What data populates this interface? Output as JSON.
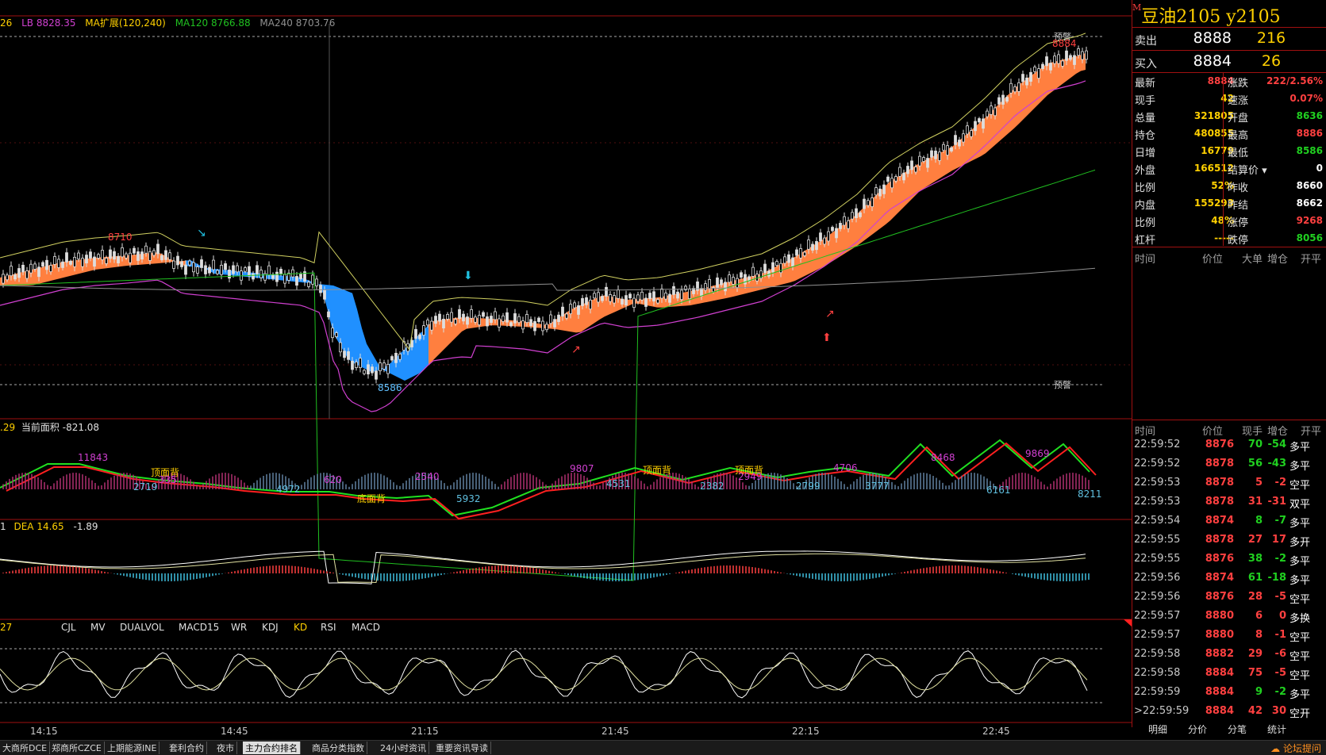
{
  "top_info": {
    "cut_value": "26",
    "lb": "LB 8828.35",
    "ma_ext": "MA扩展(120,240)",
    "ma120": "MA120 8766.88",
    "ma240": "MA240 8703.76"
  },
  "main_chart": {
    "price_high_label": "8884",
    "price_labels": [
      "8710",
      "8586"
    ],
    "warn_top": "预警",
    "warn_bottom": "预警",
    "colors": {
      "up_band": "#ff7f3f",
      "down_band": "#2090ff",
      "ma120": "#20c020",
      "ma240": "#909090",
      "boll": "#d0d060",
      "lower": "#d040d0"
    }
  },
  "volume_panel": {
    "header_prefix": ".29",
    "header": "当前面积 -821.08",
    "labels": [
      "11843",
      "顶面背",
      "2719",
      "335",
      "4972",
      "620",
      "底面背",
      "2540",
      "5932",
      "9807",
      "4531",
      "顶面背",
      "2382",
      "顶面背",
      "2949",
      "2799",
      "4706",
      "3777",
      "8468",
      "6161",
      "9869",
      "8211"
    ]
  },
  "macd_panel": {
    "header_prefix": "1",
    "dea": "DEA 14.65",
    "macd": "-1.89"
  },
  "indicator_tabs": {
    "cut": "27",
    "items": [
      "CJL",
      "MV",
      "DUALVOL",
      "MACD15",
      "WR",
      "KDJ",
      "KD",
      "RSI",
      "MACD"
    ],
    "active": "KD"
  },
  "time_axis": [
    "14:15",
    "14:45",
    "21:15",
    "21:45",
    "22:15",
    "22:45"
  ],
  "quote": {
    "title_mark": "M",
    "title": "豆油2105  y2105",
    "ask_label": "卖出",
    "ask_price": "8888",
    "ask_vol": "216",
    "bid_label": "买入",
    "bid_price": "8884",
    "bid_vol": "26",
    "stats_left": [
      {
        "label": "最新",
        "value": "8884",
        "color": "#ff4040"
      },
      {
        "label": "现手",
        "value": "42",
        "color": "#ffd000"
      },
      {
        "label": "总量",
        "value": "321805",
        "color": "#ffd000"
      },
      {
        "label": "持仓",
        "value": "480855",
        "color": "#ffd000"
      },
      {
        "label": "日增",
        "value": "16779",
        "color": "#ffd000"
      },
      {
        "label": "外盘",
        "value": "166512",
        "color": "#ffd000"
      },
      {
        "label": "比例",
        "value": "52%",
        "color": "#ffd000"
      },
      {
        "label": "内盘",
        "value": "155293",
        "color": "#ffd000"
      },
      {
        "label": "比例",
        "value": "48%",
        "color": "#ffd000"
      },
      {
        "label": "杠杆",
        "value": "-----",
        "color": "#ffd000"
      }
    ],
    "stats_right": [
      {
        "label": "涨跌",
        "value": "222/2.56%",
        "color": "#ff4040"
      },
      {
        "label": "速涨",
        "value": "0.07%",
        "color": "#ff4040"
      },
      {
        "label": "开盘",
        "value": "8636",
        "color": "#20d020"
      },
      {
        "label": "最高",
        "value": "8886",
        "color": "#ff4040"
      },
      {
        "label": "最低",
        "value": "8586",
        "color": "#20d020"
      },
      {
        "label": "结算价",
        "value": "0",
        "color": "#ffffff"
      },
      {
        "label": "昨收",
        "value": "8660",
        "color": "#ffffff"
      },
      {
        "label": "昨结",
        "value": "8662",
        "color": "#ffffff"
      },
      {
        "label": "涨停",
        "value": "9268",
        "color": "#ff4040"
      },
      {
        "label": "跌停",
        "value": "8056",
        "color": "#20d020"
      }
    ],
    "table_head": [
      "时间",
      "价位",
      "大单",
      "增仓",
      "开平"
    ],
    "tick_head": [
      "时间",
      "价位",
      "现手",
      "增仓",
      "开平"
    ]
  },
  "ticks": [
    {
      "time": "22:59:52",
      "price": "8876",
      "vol": "70",
      "oi": "-54",
      "type": "多平",
      "vc": "#20d020",
      "tc": "#ffffff"
    },
    {
      "time": "22:59:52",
      "price": "8878",
      "vol": "56",
      "oi": "-43",
      "type": "多平",
      "vc": "#20d020",
      "tc": "#ffffff"
    },
    {
      "time": "22:59:53",
      "price": "8878",
      "vol": "5",
      "oi": "-2",
      "type": "空平",
      "vc": "#ff4040",
      "tc": "#ffffff"
    },
    {
      "time": "22:59:53",
      "price": "8878",
      "vol": "31",
      "oi": "-31",
      "type": "双平",
      "vc": "#ff4040",
      "tc": "#ffffff"
    },
    {
      "time": "22:59:54",
      "price": "8874",
      "vol": "8",
      "oi": "-7",
      "type": "多平",
      "vc": "#20d020",
      "tc": "#ffffff"
    },
    {
      "time": "22:59:55",
      "price": "8878",
      "vol": "27",
      "oi": "17",
      "type": "多开",
      "vc": "#ff4040",
      "tc": "#ffffff"
    },
    {
      "time": "22:59:55",
      "price": "8876",
      "vol": "38",
      "oi": "-2",
      "type": "多平",
      "vc": "#20d020",
      "tc": "#ffffff"
    },
    {
      "time": "22:59:56",
      "price": "8874",
      "vol": "61",
      "oi": "-18",
      "type": "多平",
      "vc": "#20d020",
      "tc": "#ffffff"
    },
    {
      "time": "22:59:56",
      "price": "8876",
      "vol": "28",
      "oi": "-5",
      "type": "空平",
      "vc": "#ff4040",
      "tc": "#ffffff"
    },
    {
      "time": "22:59:57",
      "price": "8880",
      "vol": "6",
      "oi": "0",
      "type": "多换",
      "vc": "#ff4040",
      "tc": "#ffffff"
    },
    {
      "time": "22:59:57",
      "price": "8880",
      "vol": "8",
      "oi": "-1",
      "type": "空平",
      "vc": "#ff4040",
      "tc": "#ffffff"
    },
    {
      "time": "22:59:58",
      "price": "8882",
      "vol": "29",
      "oi": "-6",
      "type": "空平",
      "vc": "#ff4040",
      "tc": "#ffffff"
    },
    {
      "time": "22:59:58",
      "price": "8884",
      "vol": "75",
      "oi": "-5",
      "type": "空平",
      "vc": "#ff4040",
      "tc": "#ffffff"
    },
    {
      "time": "22:59:59",
      "price": "8884",
      "vol": "9",
      "oi": "-2",
      "type": "多平",
      "vc": "#20d020",
      "tc": "#ffffff"
    },
    {
      "time": ">22:59:59",
      "price": "8884",
      "vol": "42",
      "oi": "30",
      "type": "空开",
      "vc": "#ff4040",
      "tc": "#ffffff"
    }
  ],
  "rp_tabs": [
    "明细",
    "分价",
    "分笔",
    "统计"
  ],
  "bottom_tabs": [
    "大商所DCE",
    "郑商所CZCE",
    "上期能源INE",
    "套利合约",
    "夜市",
    "主力合约排名",
    "商品分类指数",
    "24小时资讯",
    "重要资讯导读"
  ],
  "bottom_active": "主力合约排名",
  "forum": "论坛提问"
}
